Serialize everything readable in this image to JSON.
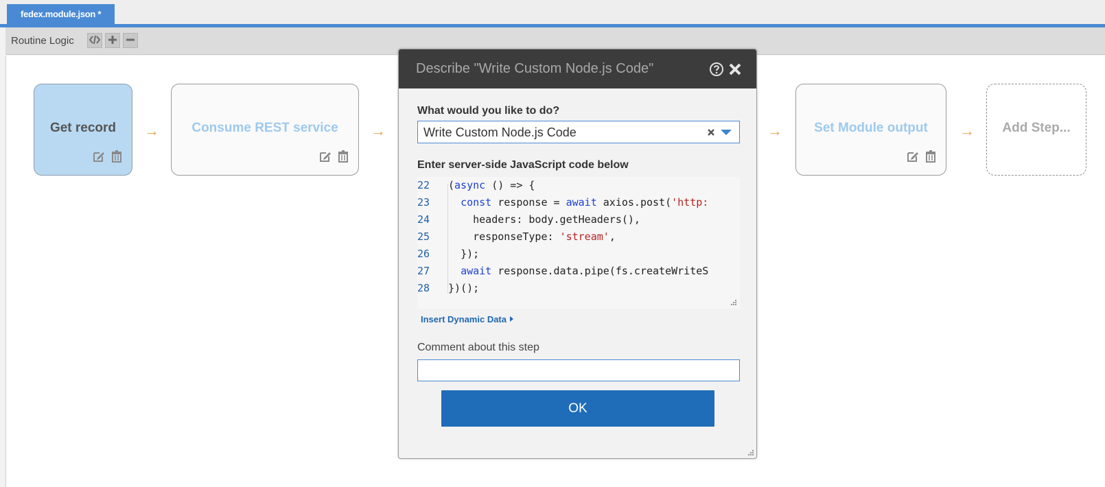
{
  "tabs": [
    {
      "label": "fedex.module.json *"
    }
  ],
  "toolbar": {
    "label": "Routine Logic"
  },
  "flow": {
    "nodes": [
      {
        "label": "Get record"
      },
      {
        "label": "Consume REST service"
      },
      {
        "label": "Set Module output"
      },
      {
        "label": "Add Step..."
      }
    ],
    "arrow": "→"
  },
  "dialog": {
    "title": "Describe \"Write Custom Node.js Code\"",
    "question": "What would you like to do?",
    "selected_action": "Write Custom Node.js Code",
    "code_label": "Enter server-side JavaScript code below",
    "code_lines": [
      {
        "num": "22",
        "indent": "",
        "parts": [
          {
            "t": "(",
            "c": ""
          },
          {
            "t": "async",
            "c": "kw"
          },
          {
            "t": " () => {",
            "c": ""
          }
        ]
      },
      {
        "num": "23",
        "indent": "  ",
        "parts": [
          {
            "t": "const",
            "c": "kw"
          },
          {
            "t": " response = ",
            "c": ""
          },
          {
            "t": "await",
            "c": "kw"
          },
          {
            "t": " axios.post(",
            "c": ""
          },
          {
            "t": "'http:",
            "c": "str"
          }
        ]
      },
      {
        "num": "24",
        "indent": "    ",
        "parts": [
          {
            "t": "headers: body.getHeaders(),",
            "c": ""
          }
        ]
      },
      {
        "num": "25",
        "indent": "    ",
        "parts": [
          {
            "t": "responseType: ",
            "c": ""
          },
          {
            "t": "'stream'",
            "c": "str"
          },
          {
            "t": ",",
            "c": ""
          }
        ]
      },
      {
        "num": "26",
        "indent": "  ",
        "parts": [
          {
            "t": "});",
            "c": ""
          }
        ]
      },
      {
        "num": "27",
        "indent": "  ",
        "parts": [
          {
            "t": "await",
            "c": "kw"
          },
          {
            "t": " response.data.pipe(fs.createWriteS",
            "c": ""
          }
        ]
      },
      {
        "num": "28",
        "indent": "",
        "parts": [
          {
            "t": "})();",
            "c": ""
          }
        ]
      }
    ],
    "insert_dynamic_label": "Insert Dynamic Data",
    "comment_label": "Comment about this step",
    "comment_value": "",
    "ok_label": "OK"
  },
  "colors": {
    "accent": "#4a8ad4",
    "ok_button": "#1f6db8",
    "arrow": "#e8a04f",
    "active_node": "#b9d9f2",
    "faded_label": "#9ec9ee"
  },
  "icons": [
    "code-icon",
    "plus-icon",
    "minus-icon",
    "edit-icon",
    "trash-icon",
    "help-icon",
    "close-icon",
    "clear-icon",
    "chevron-down-icon",
    "caret-right-icon",
    "resize-grip-icon"
  ]
}
